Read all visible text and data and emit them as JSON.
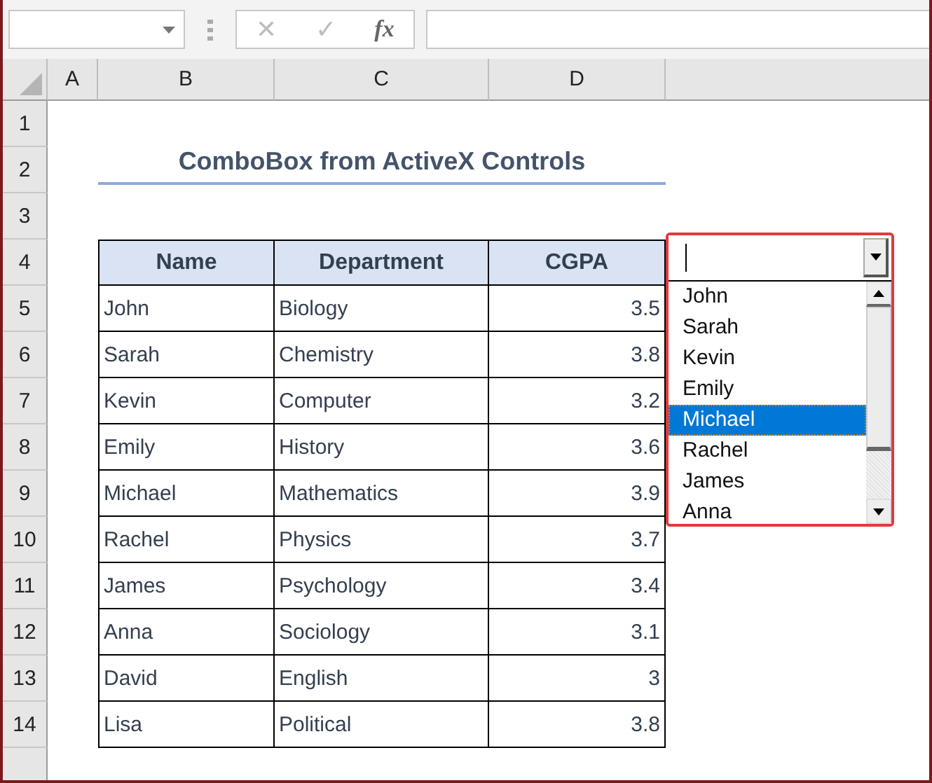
{
  "formula_bar": {
    "cancel_symbol": "✕",
    "enter_symbol": "✓",
    "function_symbol": "fx"
  },
  "column_headers": [
    "A",
    "B",
    "C",
    "D"
  ],
  "row_headers": [
    "1",
    "2",
    "3",
    "4",
    "5",
    "6",
    "7",
    "8",
    "9",
    "10",
    "11",
    "12",
    "13",
    "14"
  ],
  "title": "ComboBox from ActiveX Controls",
  "table": {
    "columns": [
      "Name",
      "Department",
      "CGPA"
    ],
    "rows": [
      [
        "John",
        "Biology",
        "3.5"
      ],
      [
        "Sarah",
        "Chemistry",
        "3.8"
      ],
      [
        "Kevin",
        "Computer",
        "3.2"
      ],
      [
        "Emily",
        "History",
        "3.6"
      ],
      [
        "Michael",
        "Mathematics",
        "3.9"
      ],
      [
        "Rachel",
        "Physics",
        "3.7"
      ],
      [
        "James",
        "Psychology",
        "3.4"
      ],
      [
        "Anna",
        "Sociology",
        "3.1"
      ],
      [
        "David",
        "English",
        "3"
      ],
      [
        "Lisa",
        "Political",
        "3.8"
      ]
    ]
  },
  "combobox": {
    "items": [
      {
        "label": "John",
        "selected": false
      },
      {
        "label": "Sarah",
        "selected": false
      },
      {
        "label": "Kevin",
        "selected": false
      },
      {
        "label": "Emily",
        "selected": false
      },
      {
        "label": "Michael",
        "selected": true
      },
      {
        "label": "Rachel",
        "selected": false
      },
      {
        "label": "James",
        "selected": false
      },
      {
        "label": "Anna",
        "selected": false
      }
    ]
  }
}
